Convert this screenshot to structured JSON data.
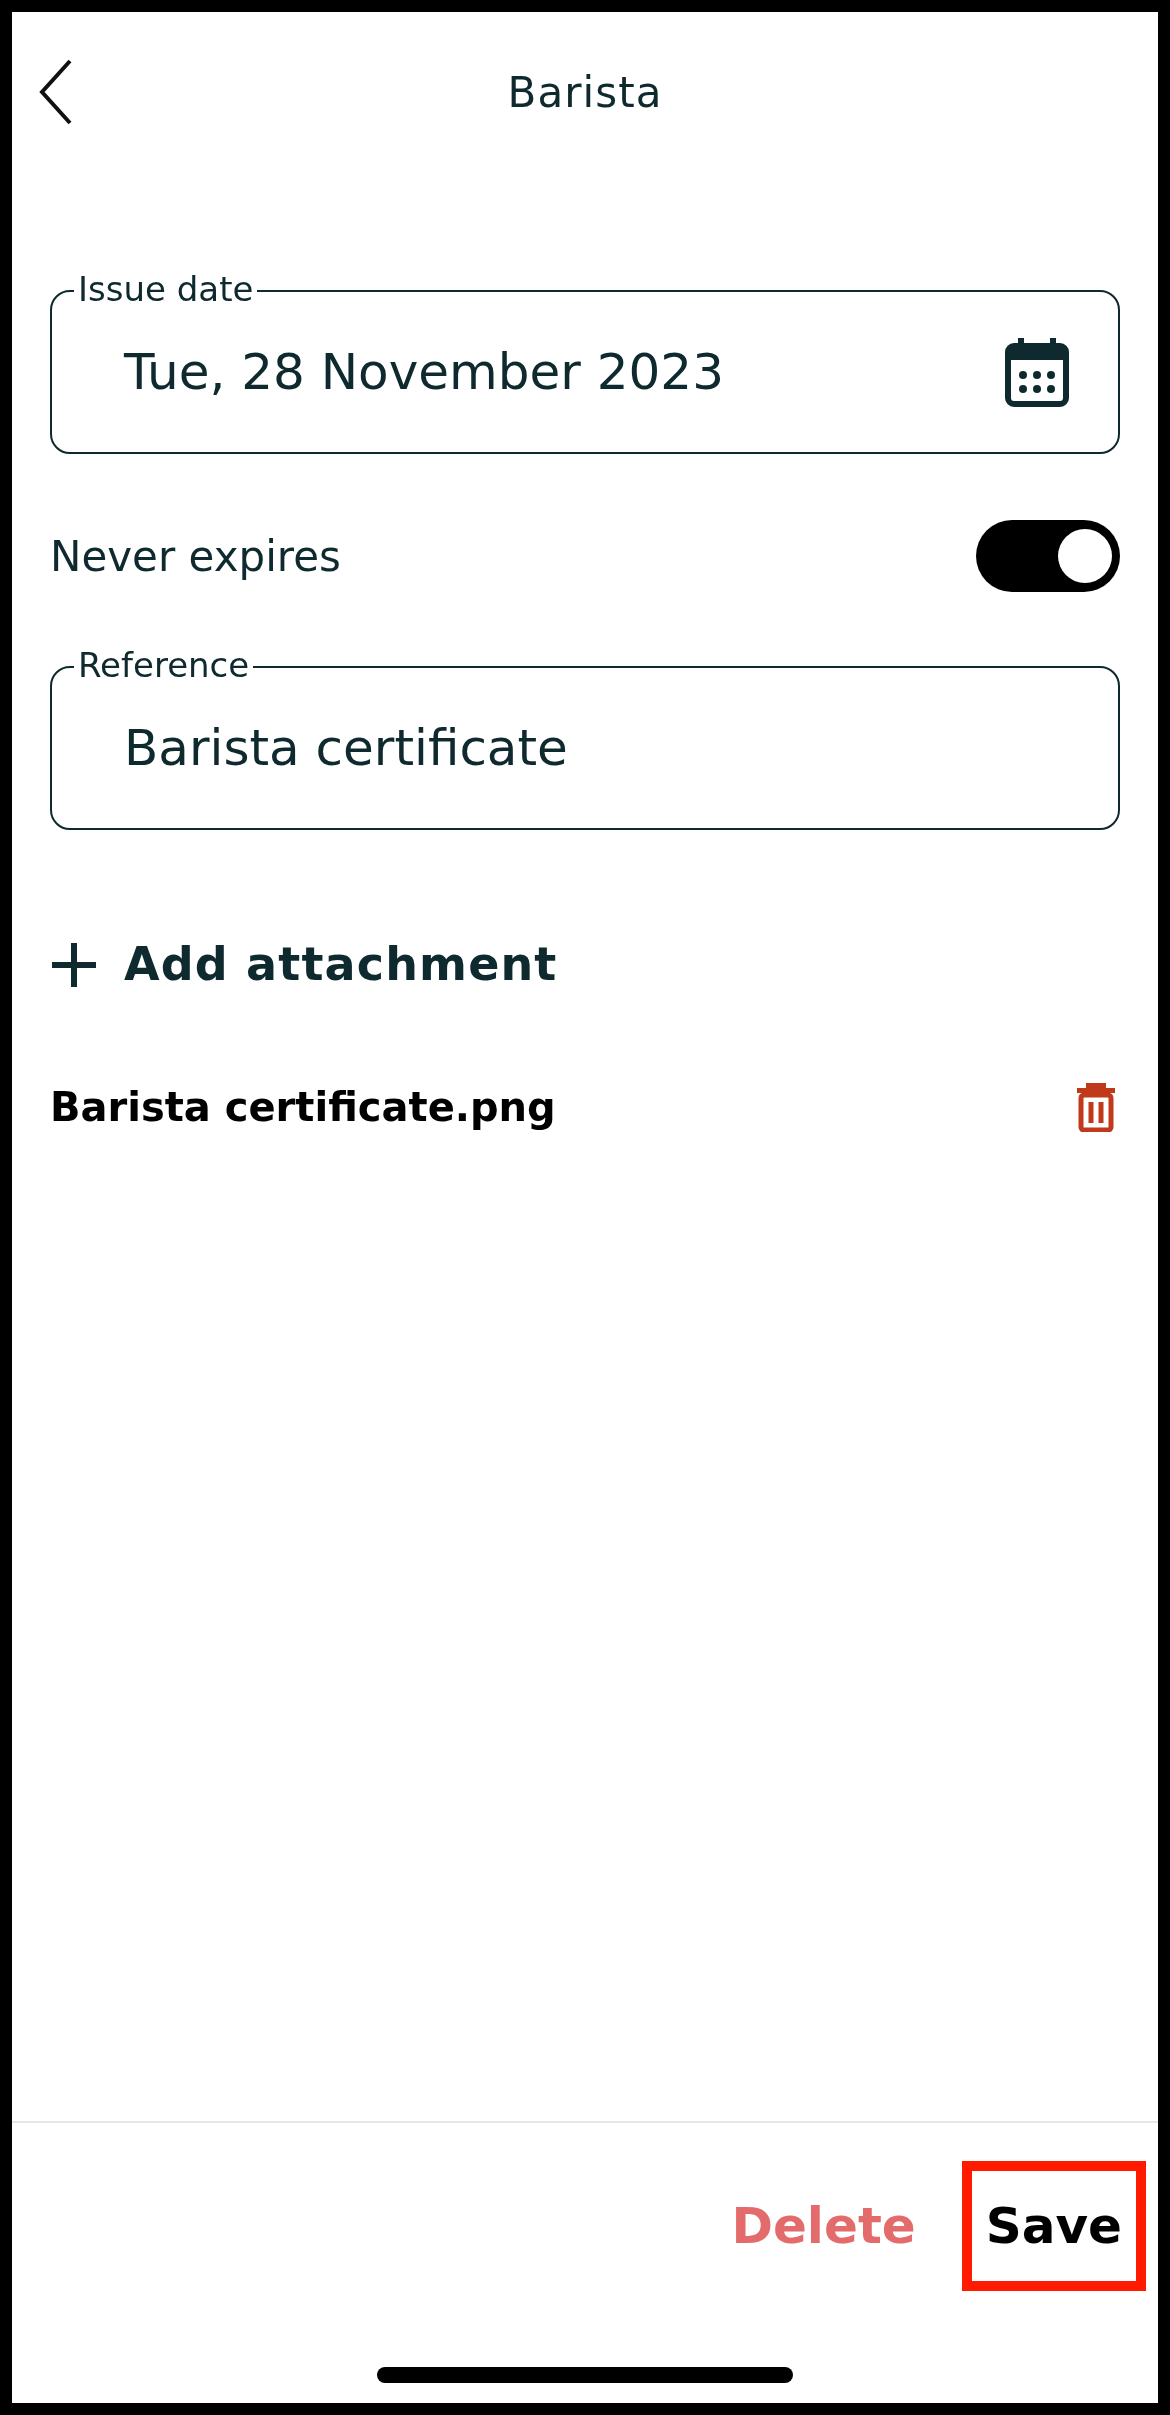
{
  "header": {
    "title": "Barista"
  },
  "issue_date": {
    "label": "Issue date",
    "value": "Tue, 28 November 2023"
  },
  "never_expires": {
    "label": "Never expires",
    "on": true
  },
  "reference": {
    "label": "Reference",
    "value": "Barista certificate"
  },
  "add_attachment": {
    "label": "Add attachment"
  },
  "attachments": [
    {
      "name": "Barista certificate.png"
    }
  ],
  "footer": {
    "buttons": [
      {
        "label": "Delete",
        "kind": "destructive",
        "highlighted": false
      },
      {
        "label": "Save",
        "kind": "primary",
        "highlighted": true
      }
    ]
  }
}
